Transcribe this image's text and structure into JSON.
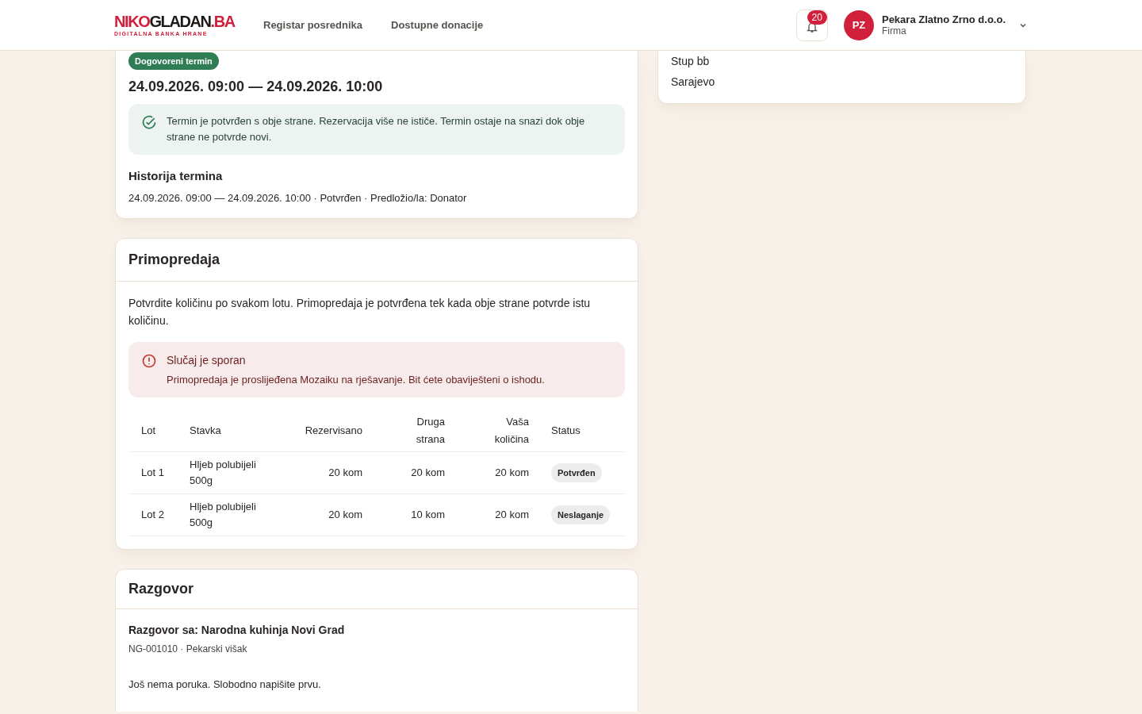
{
  "header": {
    "logo": {
      "parts": [
        {
          "text": "NIKO",
          "color": "#d21f3c"
        },
        {
          "text": "GLADAN",
          "color": "#1c1917"
        },
        {
          "text": ".BA",
          "color": "#d21f3c"
        }
      ],
      "tagline": "DIGITALNA BANKA HRANE"
    },
    "nav": [
      {
        "label": "Registar posrednika"
      },
      {
        "label": "Dostupne donacije"
      }
    ],
    "notifications": {
      "count": "20"
    },
    "user": {
      "initials": "PZ",
      "name": "Pekara Zlatno Zrno d.o.o.",
      "role": "Firma"
    }
  },
  "appointment": {
    "badge": "Dogovoreni termin",
    "time": "24.09.2026. 09:00 — 24.09.2026. 10:00",
    "notice": "Termin je potvrđen s obje strane. Rezervacija više ne ističe. Termin ostaje na snazi dok obje strane ne potvrde novi.",
    "history_title": "Historija termina",
    "history": [
      "24.09.2026. 09:00 — 24.09.2026. 10:00 · Potvrđen · Predložio/la: Donator"
    ]
  },
  "handover": {
    "title": "Primopredaja",
    "intro": "Potvrdite količinu po svakom lotu. Primopredaja je potvrđena tek kada obje strane potvrde istu količinu.",
    "alert": {
      "title": "Slučaj je sporan",
      "text": "Primopredaja je proslijeđena Mozaiku na rješavanje. Bit ćete obaviješteni o ishodu."
    },
    "table": {
      "columns": [
        "Lot",
        "Stavka",
        "Rezervisano",
        "Druga strana",
        "Vaša količina",
        "Status"
      ],
      "rows": [
        {
          "lot": "Lot 1",
          "item": "Hljeb polubijeli 500g",
          "reserved": "20 kom",
          "other": "20 kom",
          "yours": "20 kom",
          "status": "Potvrđen"
        },
        {
          "lot": "Lot 2",
          "item": "Hljeb polubijeli 500g",
          "reserved": "20 kom",
          "other": "10 kom",
          "yours": "20 kom",
          "status": "Neslaganje"
        }
      ]
    }
  },
  "chat": {
    "title": "Razgovor",
    "with": "Razgovor sa: Narodna kuhinja Novi Grad",
    "meta": "NG-001010 · Pekarski višak",
    "empty": "Još nema poruka. Slobodno napišite prvu."
  },
  "address": {
    "lines": [
      "Stup bb",
      "Sarajevo"
    ]
  }
}
